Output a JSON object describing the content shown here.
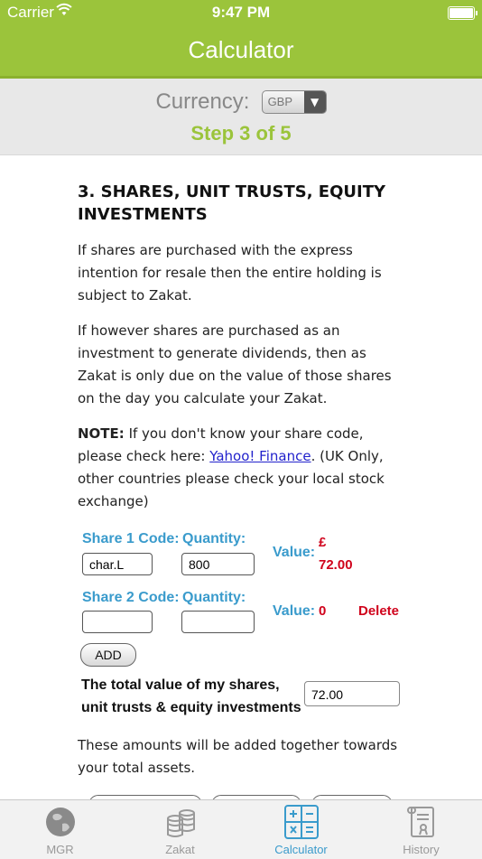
{
  "status_bar": {
    "carrier": "Carrier",
    "time": "9:47 PM"
  },
  "nav": {
    "title": "Calculator"
  },
  "currency": {
    "label": "Currency:",
    "selected": "GBP"
  },
  "step": "Step 3 of 5",
  "section": {
    "heading": "3. SHARES, UNIT TRUSTS, EQUITY INVESTMENTS",
    "para1": "If shares are purchased with the express intention for resale then the entire holding is subject to Zakat.",
    "para2": "If however shares are purchased as an investment to generate dividends, then as Zakat is only due on the value of those shares on the day you calculate your Zakat.",
    "note_label": "NOTE:",
    "note_text": " If you don't know your share code, please check here: ",
    "note_link": "Yahoo! Finance",
    "note_tail": ". (UK Only, other countries please check your local stock exchange)"
  },
  "shares": [
    {
      "code_label": "Share 1 Code:",
      "qty_label": "Quantity:",
      "code": "char.L",
      "qty": "800",
      "value_label": "Value:",
      "value_currency": "£",
      "value": "72.00",
      "delete": ""
    },
    {
      "code_label": "Share 2 Code:",
      "qty_label": "Quantity:",
      "code": "",
      "qty": "",
      "value_label": "Value:",
      "value_currency": "",
      "value": "0",
      "delete": "Delete"
    }
  ],
  "add_label": "ADD",
  "total": {
    "label": "The total value of my shares, unit trusts & equity investments",
    "value": "72.00"
  },
  "footer_text": "These amounts will be added together towards your total assets.",
  "tabs": [
    {
      "label": "MGR",
      "icon": "globe-icon"
    },
    {
      "label": "Zakat",
      "icon": "coins-icon"
    },
    {
      "label": "Calculator",
      "icon": "calculator-icon"
    },
    {
      "label": "History",
      "icon": "scroll-icon"
    }
  ],
  "colors": {
    "brand": "#9bc43b",
    "accent": "#3a9bcc",
    "alert": "#d0021b"
  }
}
